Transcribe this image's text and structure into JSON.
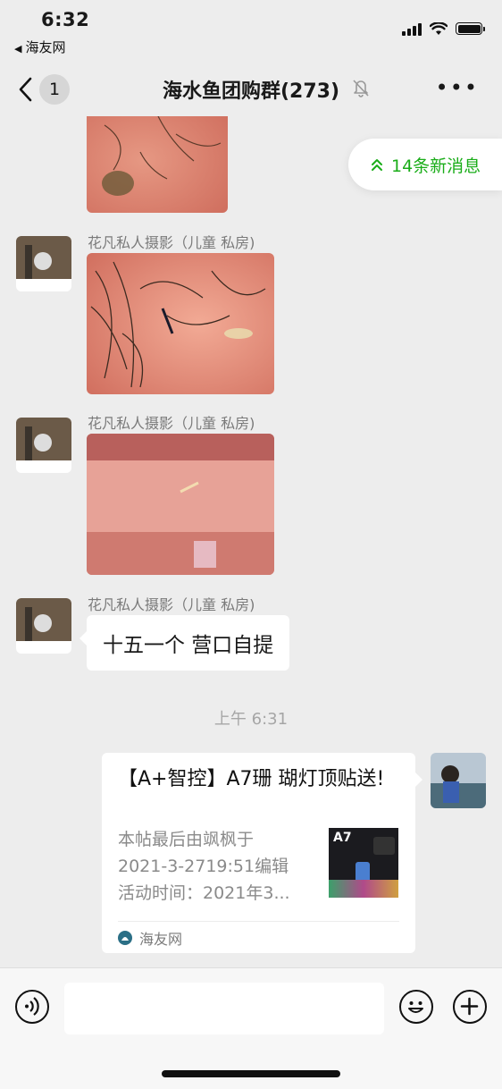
{
  "status_bar": {
    "time": "6:32",
    "back_app": "海友网",
    "back_arrow": "◀"
  },
  "header": {
    "unread_count": "1",
    "title": "海水鱼团购群(273)",
    "more": "•••"
  },
  "new_messages_pill": {
    "label": "14条新消息",
    "icon": "double-chevron-up-icon",
    "color": "#1aad19"
  },
  "messages": [
    {
      "sender": "花凡私人摄影（儿童 私房)",
      "type": "image"
    },
    {
      "sender": "花凡私人摄影（儿童 私房)",
      "type": "image"
    },
    {
      "sender": "花凡私人摄影（儿童 私房)",
      "type": "text",
      "text": "十五一个 营口自提"
    }
  ],
  "timestamp": "上午 6:31",
  "link_card": {
    "title": "【A+智控】A7珊 瑚灯顶贴送!",
    "description": "本帖最后由飒枫于\n2021-3-2719:51编辑\n活动时间：2021年3...",
    "thumb_text": "A7",
    "source": "海友网"
  },
  "input_bar": {
    "voice_icon": "voice-icon",
    "emoji_icon": "emoji-icon",
    "plus_icon": "plus-icon"
  },
  "colors": {
    "chat_bg": "#ededed",
    "bubble": "#ffffff",
    "accent": "#1aad19"
  }
}
